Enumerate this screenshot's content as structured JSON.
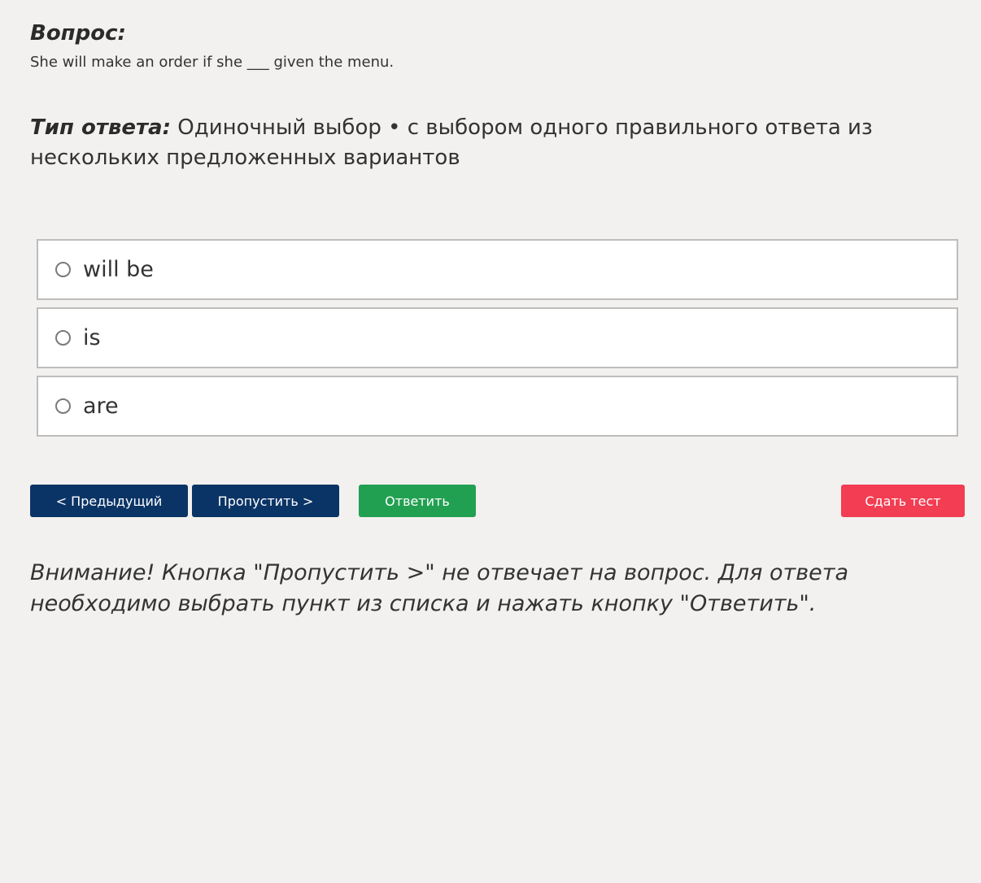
{
  "question": {
    "heading": "Вопрос:",
    "text": "She will make an order if she ___ given the menu."
  },
  "answer_type": {
    "label": "Тип ответа:",
    "value": " Одиночный выбор • с выбором одного правильного ответа из нескольких предложенных вариантов"
  },
  "options": [
    {
      "label": "will be"
    },
    {
      "label": "is"
    },
    {
      "label": "are"
    }
  ],
  "buttons": {
    "prev": "< Предыдущий",
    "skip": "Пропустить >",
    "answer": "Ответить",
    "submit": "Сдать тест"
  },
  "colors": {
    "nav_button": "#0b3466",
    "answer_button": "#22a052",
    "submit_button": "#f23d52",
    "background": "#f2f1ef"
  },
  "warning": "Внимание! Кнопка \"Пропустить >\" не отвечает на вопрос. Для ответа необходимо выбрать пункт из списка и нажать кнопку \"Ответить\"."
}
